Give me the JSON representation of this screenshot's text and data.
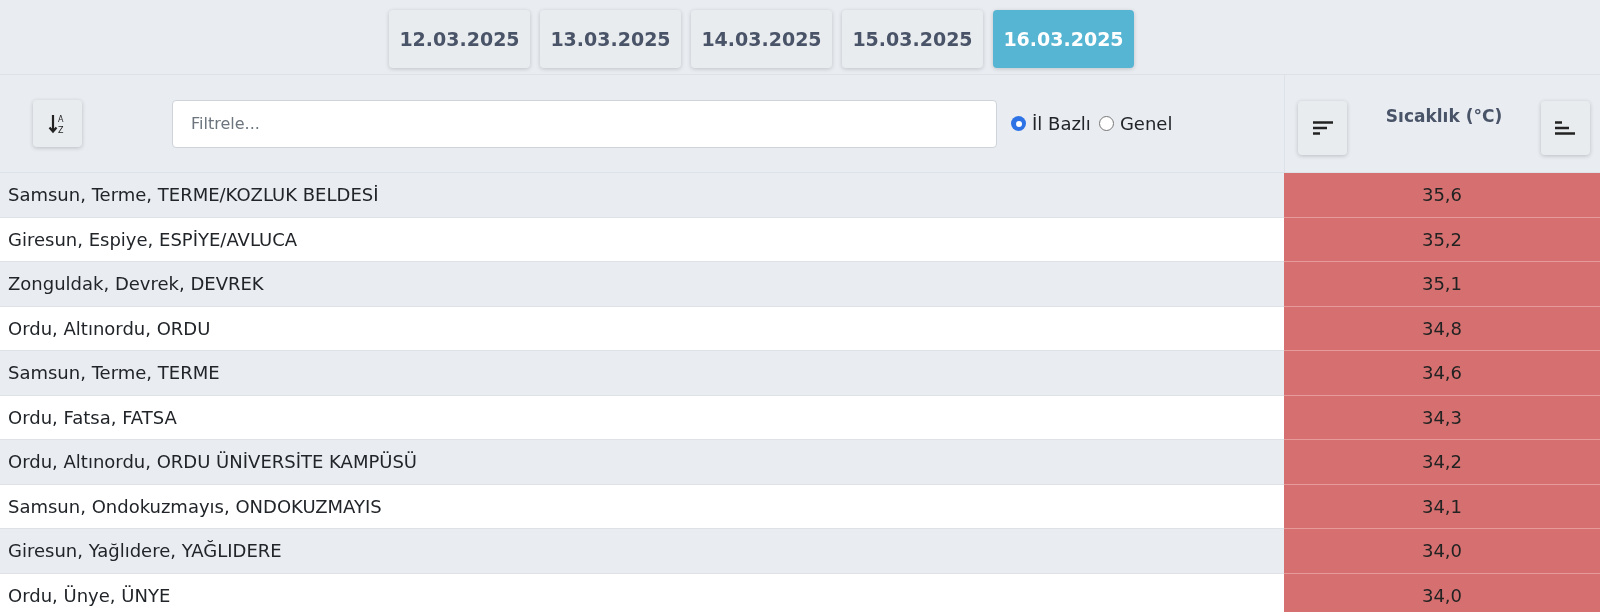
{
  "date_tabs": [
    {
      "label": "12.03.2025",
      "selected": false
    },
    {
      "label": "13.03.2025",
      "selected": false
    },
    {
      "label": "14.03.2025",
      "selected": false
    },
    {
      "label": "15.03.2025",
      "selected": false
    },
    {
      "label": "16.03.2025",
      "selected": true
    }
  ],
  "alpha_sort_button": {
    "top_letter": "A",
    "bottom_letter": "Z"
  },
  "filter": {
    "placeholder": "Filtrele..."
  },
  "scope_options": [
    {
      "label": "İl Bazlı",
      "selected": true
    },
    {
      "label": "Genel",
      "selected": false
    }
  ],
  "value_column": {
    "title": "Sıcaklık (°C)"
  },
  "rows": [
    {
      "location": "Samsun, Terme, TERME/KOZLUK BELDESİ",
      "value": "35,6"
    },
    {
      "location": "Giresun, Espiye, ESPİYE/AVLUCA",
      "value": "35,2"
    },
    {
      "location": "Zonguldak, Devrek, DEVREK",
      "value": "35,1"
    },
    {
      "location": "Ordu, Altınordu, ORDU",
      "value": "34,8"
    },
    {
      "location": "Samsun, Terme, TERME",
      "value": "34,6"
    },
    {
      "location": "Ordu, Fatsa, FATSA",
      "value": "34,3"
    },
    {
      "location": "Ordu, Altınordu, ORDU ÜNİVERSİTE KAMPÜSÜ",
      "value": "34,2"
    },
    {
      "location": "Samsun, Ondokuzmayıs, ONDOKUZMAYIS",
      "value": "34,1"
    },
    {
      "location": "Giresun, Yağlıdere, YAĞLIDERE",
      "value": "34,0"
    },
    {
      "location": "Ordu, Ünye, ÜNYE",
      "value": "34,0"
    }
  ]
}
